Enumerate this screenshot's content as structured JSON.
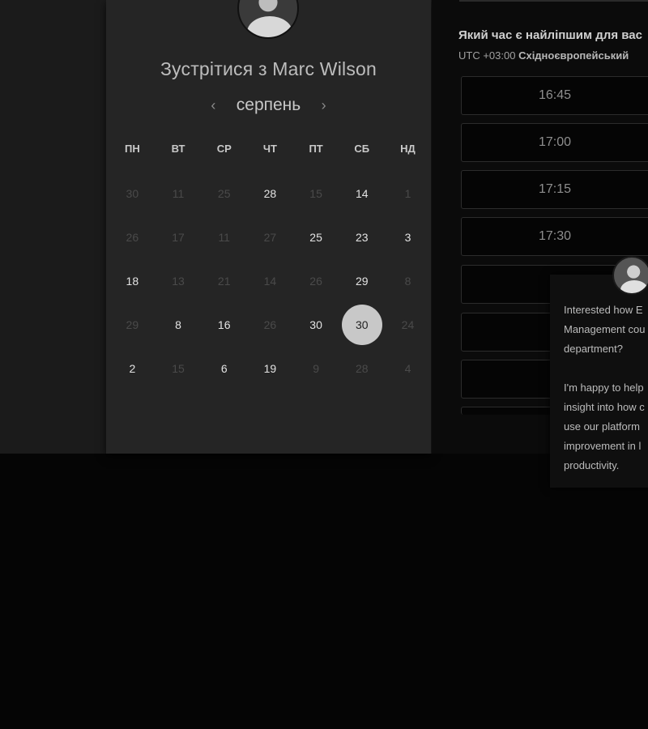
{
  "calendar": {
    "title": "Зустрітися з Marc Wilson",
    "month": "серпень",
    "prev_icon": "‹",
    "next_icon": "›",
    "weekdays": [
      "ПН",
      "ВТ",
      "СР",
      "ЧТ",
      "ПТ",
      "СБ",
      "НД"
    ],
    "weeks": [
      [
        {
          "d": "30",
          "m": true
        },
        {
          "d": "11",
          "m": true
        },
        {
          "d": "25",
          "m": true
        },
        {
          "d": "28",
          "m": false
        },
        {
          "d": "15",
          "m": true
        },
        {
          "d": "14",
          "m": false
        },
        {
          "d": "1",
          "m": true
        }
      ],
      [
        {
          "d": "26",
          "m": true
        },
        {
          "d": "17",
          "m": true
        },
        {
          "d": "11",
          "m": true
        },
        {
          "d": "27",
          "m": true
        },
        {
          "d": "25",
          "m": false
        },
        {
          "d": "23",
          "m": false
        },
        {
          "d": "3",
          "m": false
        }
      ],
      [
        {
          "d": "18",
          "m": false
        },
        {
          "d": "13",
          "m": true
        },
        {
          "d": "21",
          "m": true
        },
        {
          "d": "14",
          "m": true
        },
        {
          "d": "26",
          "m": true
        },
        {
          "d": "29",
          "m": false
        },
        {
          "d": "8",
          "m": true
        }
      ],
      [
        {
          "d": "29",
          "m": true
        },
        {
          "d": "8",
          "m": false
        },
        {
          "d": "16",
          "m": false
        },
        {
          "d": "26",
          "m": true
        },
        {
          "d": "30",
          "m": false
        },
        {
          "d": "30",
          "m": false,
          "sel": true
        },
        {
          "d": "24",
          "m": true
        }
      ],
      [
        {
          "d": "2",
          "m": false
        },
        {
          "d": "15",
          "m": true
        },
        {
          "d": "6",
          "m": false
        },
        {
          "d": "19",
          "m": false
        },
        {
          "d": "9",
          "m": true
        },
        {
          "d": "28",
          "m": true
        },
        {
          "d": "4",
          "m": true
        }
      ]
    ]
  },
  "times": {
    "heading": "Який час є найліпшим для вас",
    "tz_offset": "UTC +03:00",
    "tz_name": "Східноєвропейський",
    "slots": [
      "16:45",
      "17:00",
      "17:15",
      "17:30",
      "",
      "",
      "",
      ""
    ]
  },
  "chat": {
    "message": "Interested how E\nManagement cou\ndepartment?\n\nI'm happy to help\ninsight into how c\nuse our platform\nimprovement in l\nproductivity."
  }
}
